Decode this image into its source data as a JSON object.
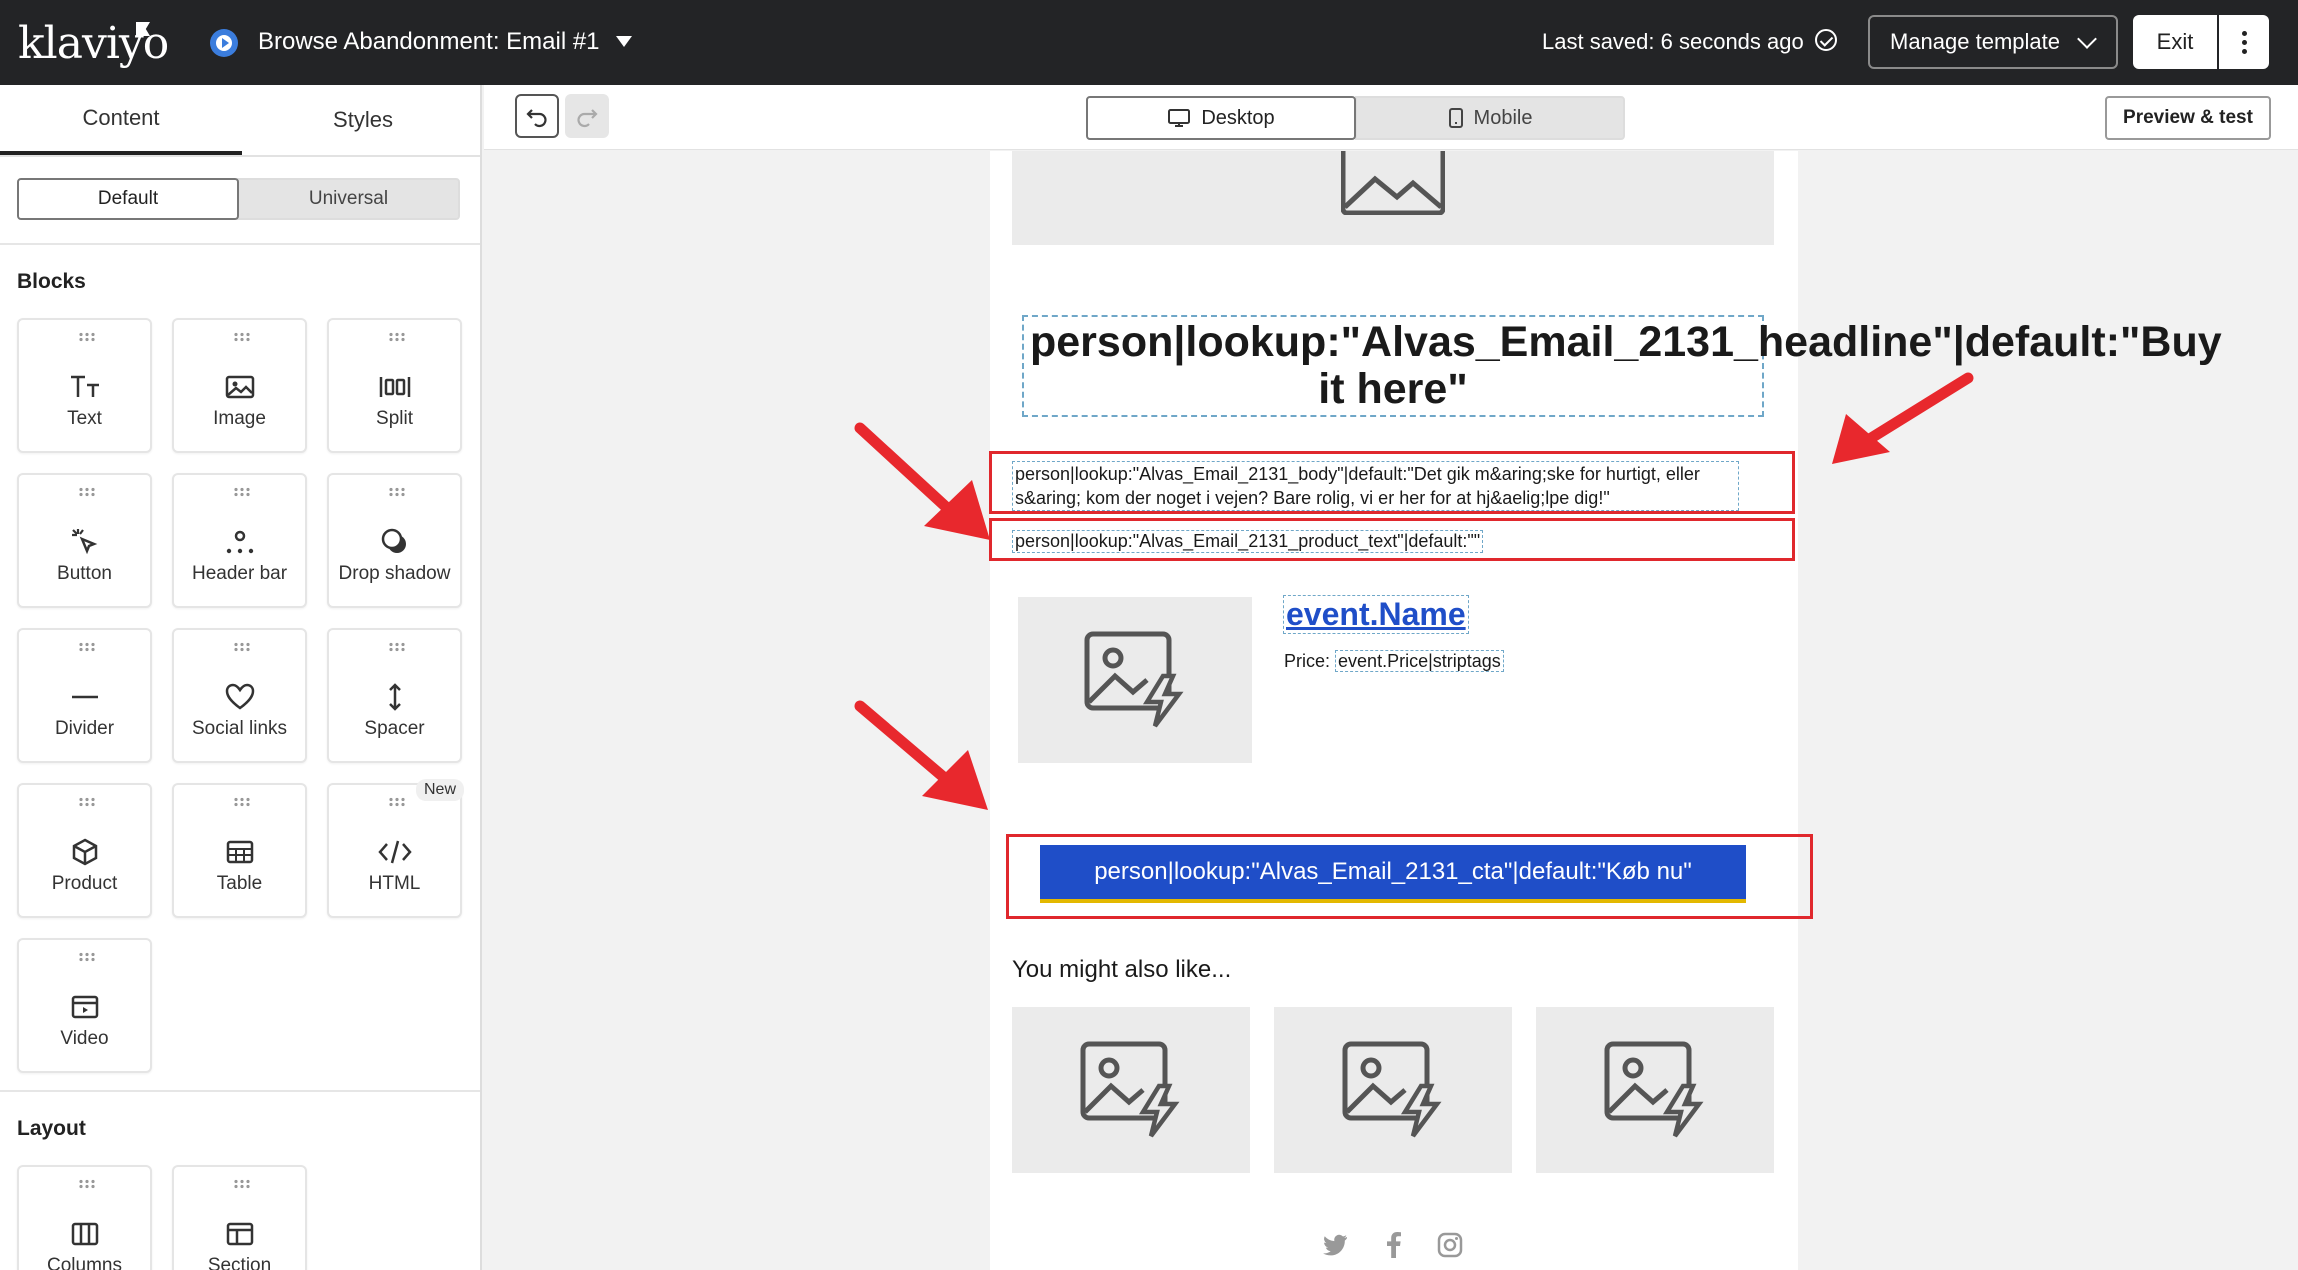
{
  "header": {
    "logo": "klaviyo",
    "title": "Browse Abandonment: Email #1",
    "saved_status": "Last saved: 6 seconds ago",
    "manage_label": "Manage template",
    "exit_label": "Exit"
  },
  "left_panel": {
    "tabs": [
      "Content",
      "Styles"
    ],
    "segments": [
      "Default",
      "Universal"
    ],
    "blocks_heading": "Blocks",
    "blocks": [
      {
        "label": "Text",
        "icon": "text-icon"
      },
      {
        "label": "Image",
        "icon": "image-icon"
      },
      {
        "label": "Split",
        "icon": "split-icon"
      },
      {
        "label": "Button",
        "icon": "button-icon"
      },
      {
        "label": "Header bar",
        "icon": "header-bar-icon"
      },
      {
        "label": "Drop shadow",
        "icon": "drop-shadow-icon"
      },
      {
        "label": "Divider",
        "icon": "divider-icon"
      },
      {
        "label": "Social links",
        "icon": "heart-icon"
      },
      {
        "label": "Spacer",
        "icon": "spacer-icon"
      },
      {
        "label": "Product",
        "icon": "product-icon"
      },
      {
        "label": "Table",
        "icon": "table-icon"
      },
      {
        "label": "HTML",
        "icon": "code-icon",
        "badge": "New"
      },
      {
        "label": "Video",
        "icon": "video-icon"
      }
    ],
    "layout_heading": "Layout",
    "layout_blocks": [
      {
        "label": "Columns",
        "icon": "columns-icon"
      },
      {
        "label": "Section",
        "icon": "section-icon"
      }
    ]
  },
  "toolbar": {
    "desktop_label": "Desktop",
    "mobile_label": "Mobile",
    "preview_label": "Preview & test"
  },
  "email": {
    "headline": "person|lookup:\"Alvas_Email_2131_headline\"|default:\"Buy it here\"",
    "body": "person|lookup:\"Alvas_Email_2131_body\"|default:\"Det gik m&aring;ske for hurtigt, eller s&aring; kom der noget i vejen? Bare rolig, vi er her for at hj&aelig;lpe dig!\"",
    "product_text": "person|lookup:\"Alvas_Email_2131_product_text\"|default:\"\"",
    "event_name": "event.Name",
    "price_label": "Price:",
    "price_value": "event.Price|striptags",
    "cta": "person|lookup:\"Alvas_Email_2131_cta\"|default:\"Køb nu\"",
    "also_like": "You might also like...",
    "social_icons": [
      "twitter-icon",
      "facebook-icon",
      "instagram-icon"
    ]
  },
  "colors": {
    "topbar": "#232426",
    "cta": "#1f4ec8",
    "annotation_red": "#e0282d"
  }
}
